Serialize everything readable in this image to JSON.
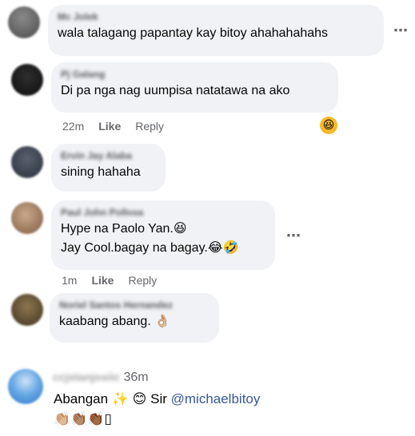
{
  "comments": [
    {
      "author": "Mc Jolek",
      "text": "wala talagang papantay kay bitoy ahahahahahs",
      "avatar_color": "#5a5a5a"
    },
    {
      "author": "Pj Galang",
      "text": "Di pa nga nag uumpisa natatawa na ako",
      "time": "22m",
      "like": "Like",
      "reply": "Reply",
      "avatar_color": "#1c1c1c",
      "reaction": "😆"
    },
    {
      "author": "Ervin Jay Alaba",
      "text": "sining hahaha",
      "avatar_color": "#3d4350"
    },
    {
      "author": "Paul John Pollosa",
      "text_line1": "Hype na Paolo Yan.😆",
      "text_line2": "Jay Cool.bagay na bagay.😂🤣",
      "time": "1m",
      "like": "Like",
      "reply": "Reply",
      "avatar_color": "#a8866a"
    },
    {
      "author": "Noriel Santos Hernandez",
      "text": "kaabang abang. 👌🏼",
      "avatar_color": "#6b5a3c"
    },
    {
      "author": "ccjstanjosiic",
      "time": "36m",
      "text_line1_a": "Abangan ✨ 😊 Sir ",
      "mention": "@michaelbitoy",
      "text_line2": "👏🏼👏🏽👏🏾▯",
      "avatar_color": "#3b8ad8"
    }
  ],
  "more_icon": "⋯"
}
